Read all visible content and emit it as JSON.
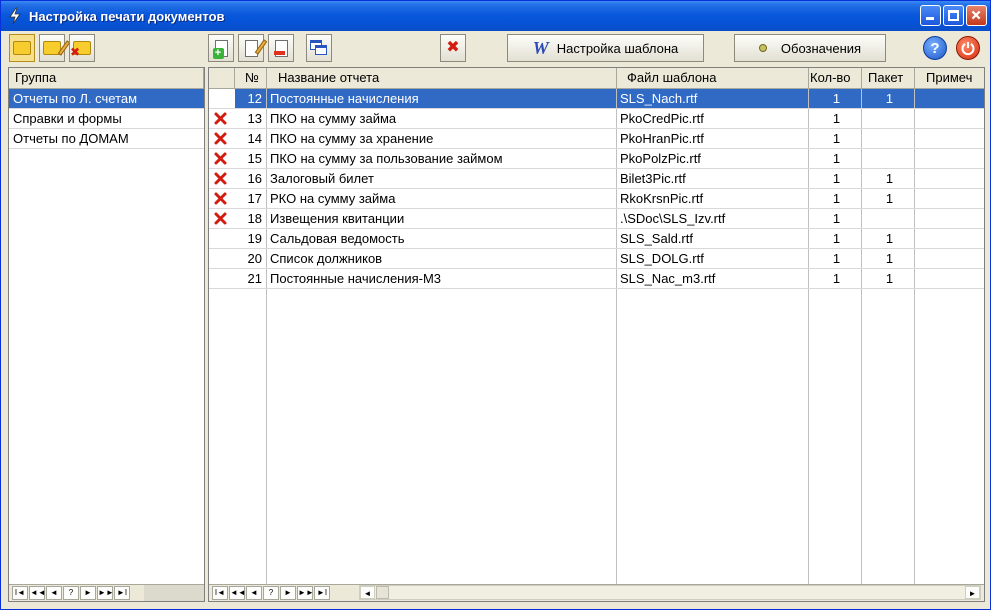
{
  "window": {
    "title": "Настройка печати документов"
  },
  "toolbar": {
    "template_settings_label": "Настройка шаблона",
    "legend_label": "Обозначения",
    "help_symbol": "?"
  },
  "groups": {
    "header": "Группа",
    "items": [
      {
        "label": "Отчеты по Л. счетам",
        "selected": true
      },
      {
        "label": "Справки и формы",
        "selected": false
      },
      {
        "label": "Отчеты по ДОМАМ",
        "selected": false
      }
    ]
  },
  "reports": {
    "columns": {
      "num": "№",
      "name": "Название отчета",
      "file": "Файл шаблона",
      "count": "Кол-во",
      "batch": "Пакет",
      "note": "Примеч"
    },
    "rows": [
      {
        "marked": false,
        "num": "12",
        "name": "Постоянные начисления",
        "file": "SLS_Nach.rtf",
        "count": "1",
        "batch": "1",
        "selected": true
      },
      {
        "marked": true,
        "num": "13",
        "name": "ПКО на сумму займа",
        "file": "PkoCredPic.rtf",
        "count": "1",
        "batch": "",
        "selected": false
      },
      {
        "marked": true,
        "num": "14",
        "name": "ПКО на сумму за хранение",
        "file": "PkoHranPic.rtf",
        "count": "1",
        "batch": "",
        "selected": false
      },
      {
        "marked": true,
        "num": "15",
        "name": "ПКО на сумму за пользование займом",
        "file": "PkoPolzPic.rtf",
        "count": "1",
        "batch": "",
        "selected": false
      },
      {
        "marked": true,
        "num": "16",
        "name": "Залоговый билет",
        "file": "Bilet3Pic.rtf",
        "count": "1",
        "batch": "1",
        "selected": false
      },
      {
        "marked": true,
        "num": "17",
        "name": "РКО на сумму займа",
        "file": "RkoKrsnPic.rtf",
        "count": "1",
        "batch": "1",
        "selected": false
      },
      {
        "marked": true,
        "num": "18",
        "name": "Извещения квитанции",
        "file": ".\\SDoc\\SLS_Izv.rtf",
        "count": "1",
        "batch": "",
        "selected": false
      },
      {
        "marked": false,
        "num": "19",
        "name": "Сальдовая ведомость",
        "file": "SLS_Sald.rtf",
        "count": "1",
        "batch": "1",
        "selected": false
      },
      {
        "marked": false,
        "num": "20",
        "name": "Список должников",
        "file": "SLS_DOLG.rtf",
        "count": "1",
        "batch": "1",
        "selected": false
      },
      {
        "marked": false,
        "num": "21",
        "name": "Постоянные начисления-М3",
        "file": "SLS_Nac_m3.rtf",
        "count": "1",
        "batch": "1",
        "selected": false
      }
    ]
  },
  "navigator": {
    "buttons": [
      "I◄",
      "◄◄",
      "◄",
      "?",
      "►",
      "►►",
      "►I"
    ]
  },
  "colors": {
    "selection": "#316ac5",
    "titlebar": "#0a58dc",
    "marker": "#d21c10"
  }
}
